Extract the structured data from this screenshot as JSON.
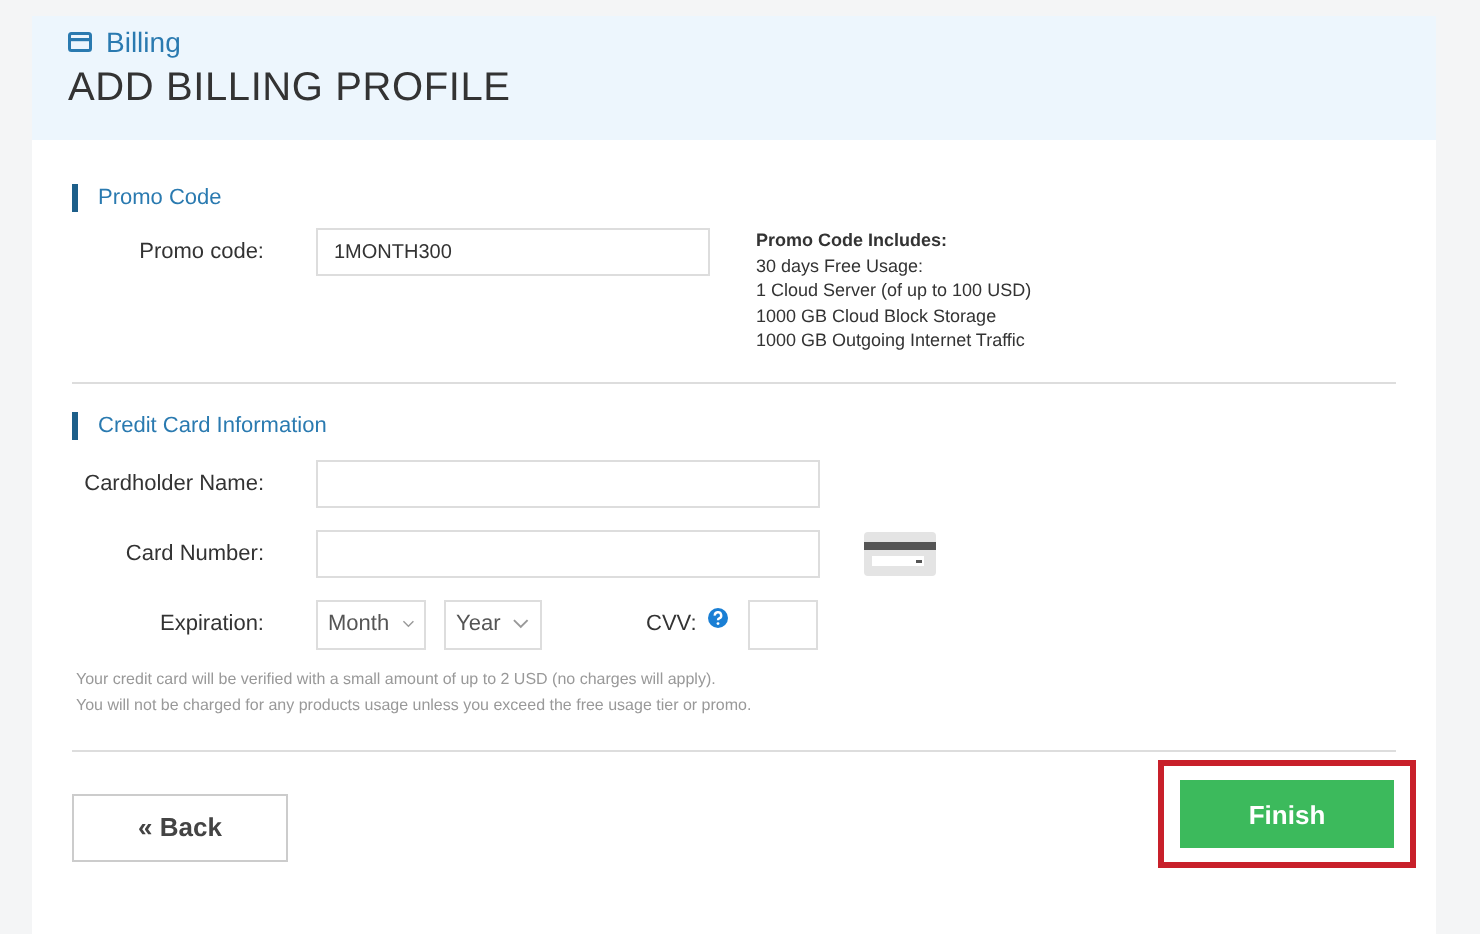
{
  "breadcrumb": "Billing",
  "title": "ADD BILLING PROFILE",
  "promo": {
    "heading": "Promo Code",
    "label": "Promo code:",
    "value": "1MONTH300",
    "includes_title": "Promo Code Includes:",
    "includes": [
      "30 days Free Usage:",
      "1 Cloud Server (of up to 100 USD)",
      "1000 GB Cloud Block Storage",
      "1000 GB Outgoing Internet Traffic"
    ]
  },
  "card": {
    "heading": "Credit Card Information",
    "cardholder_label": "Cardholder Name:",
    "number_label": "Card Number:",
    "expiration_label": "Expiration:",
    "month": "Month",
    "year": "Year",
    "cvv_label": "CVV:",
    "notes": [
      "Your credit card will be verified with a small amount of up to 2 USD (no charges will apply).",
      "You will not be charged for any products usage unless you exceed the free usage tier or promo."
    ]
  },
  "buttons": [
    {
      "kind": "back",
      "label": "« Back",
      "highlighted": false
    },
    {
      "kind": "finish",
      "label": "Finish",
      "highlighted": true
    }
  ]
}
